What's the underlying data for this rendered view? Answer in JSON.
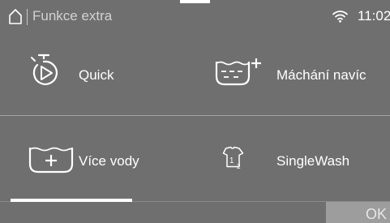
{
  "header": {
    "title": "Funkce extra",
    "time": "11:02",
    "home_icon": "home-icon",
    "wifi_icon": "wifi-icon"
  },
  "options": [
    {
      "label": "Quick",
      "icon": "stopwatch-play-icon"
    },
    {
      "label": "Máchání navíc",
      "icon": "tub-plus-icon"
    },
    {
      "label": "Více vody",
      "icon": "tub-water-plus-icon"
    },
    {
      "label": "SingleWash",
      "icon": "single-shirt-icon"
    }
  ],
  "footer": {
    "ok_label": "OK"
  },
  "colors": {
    "background": "#6f6f6f",
    "ok_button": "#9d9d9d",
    "text": "#ffffff"
  }
}
